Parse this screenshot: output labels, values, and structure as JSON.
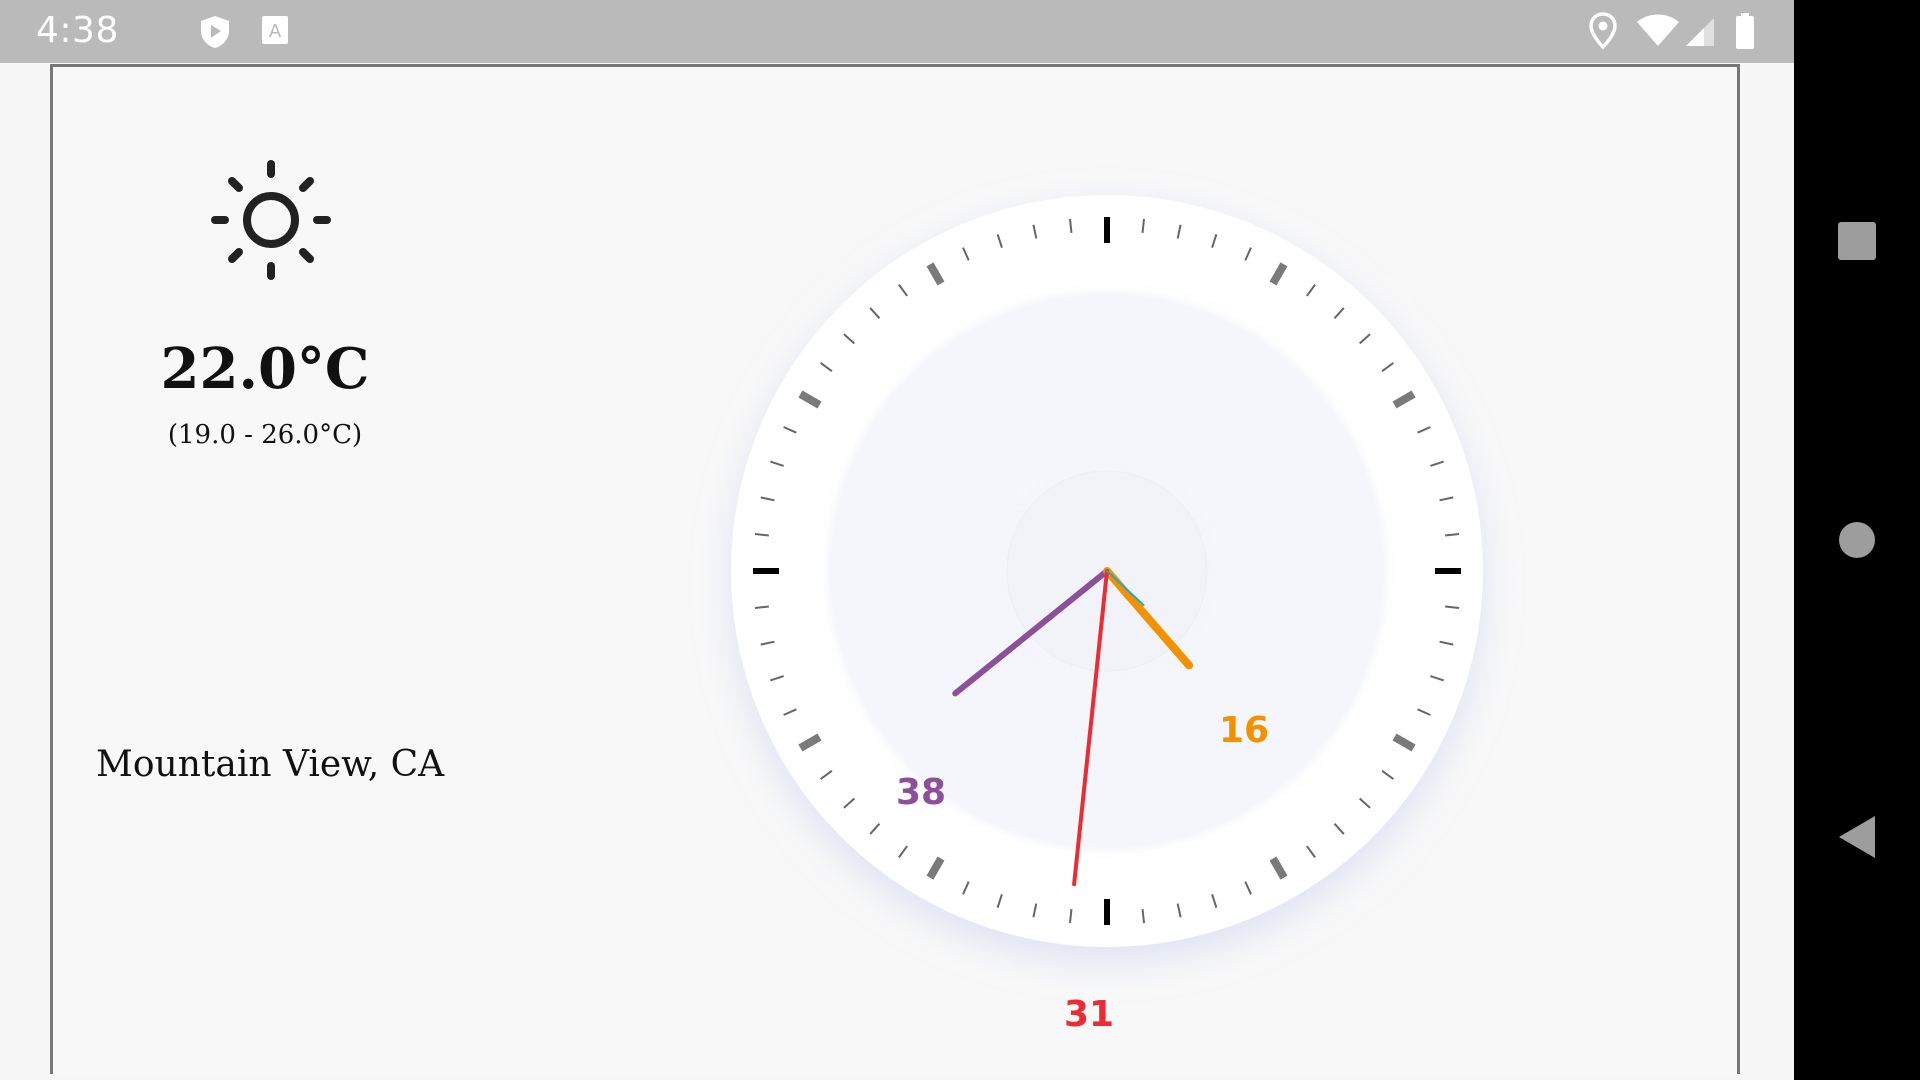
{
  "status_bar": {
    "time": "4:38",
    "left_icons": [
      "shield-play-icon",
      "keyboard-a-icon"
    ],
    "right_icons": [
      "location-pin-icon",
      "wifi-icon",
      "signal-icon",
      "battery-icon"
    ]
  },
  "nav_bar": {
    "buttons": [
      "recents-button",
      "home-button",
      "back-button"
    ]
  },
  "weather": {
    "icon": "sun-icon",
    "temperature": "22.0°C",
    "range": "(19.0 - 26.0°C)",
    "location": "Mountain View, CA"
  },
  "clock": {
    "hour_value": 16,
    "minute_value": 38,
    "second_value": 31,
    "hour_label": "16",
    "minute_label": "38",
    "second_label": "31",
    "colors": {
      "hour": "#f39200",
      "minute": "#8e4f9a",
      "second": "#ee2a32",
      "accent": "#21a9c8"
    }
  }
}
